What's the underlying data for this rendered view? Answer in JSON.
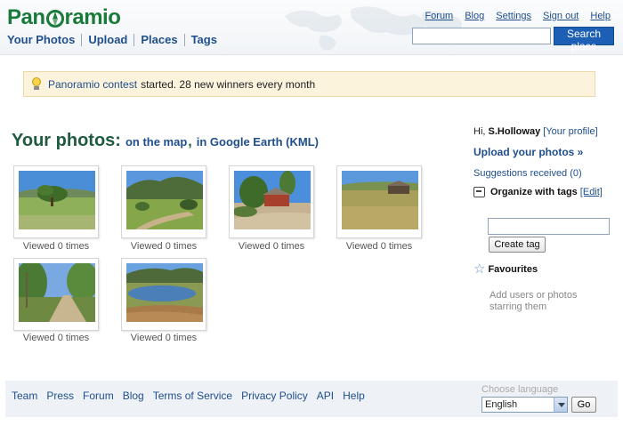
{
  "header": {
    "logo": {
      "before": "Pan",
      "after": "ramio"
    },
    "nav": [
      "Your Photos",
      "Upload",
      "Places",
      "Tags"
    ],
    "top_links": [
      "Forum",
      "Blog",
      "Settings",
      "Sign out",
      "Help"
    ],
    "search": {
      "value": "",
      "button": "Search place"
    }
  },
  "notice": {
    "link": "Panoramio contest",
    "text": "started. 28 new winners every month"
  },
  "title": {
    "main": "Your photos:",
    "map_link": "on the map",
    "comma": ",",
    "earth_link": "in Google Earth (KML)"
  },
  "photos": [
    {
      "caption": "Viewed 0 times"
    },
    {
      "caption": "Viewed 0 times"
    },
    {
      "caption": "Viewed 0 times"
    },
    {
      "caption": "Viewed 0 times"
    },
    {
      "caption": "Viewed 0 times"
    },
    {
      "caption": "Viewed 0 times"
    }
  ],
  "sidebar": {
    "greeting": "Hi,",
    "username": "S.Holloway",
    "profile_link": "[Your profile]",
    "upload_link": "Upload your photos »",
    "suggestions": "Suggestions received (0)",
    "tags_title": "Organize with tags",
    "tags_edit": "[Edit]",
    "tag_input_value": "",
    "create_tag_button": "Create tag",
    "favourites_title": "Favourites",
    "favourites_note": "Add users or photos starring them"
  },
  "footer": {
    "links": [
      "Team",
      "Press",
      "Forum",
      "Blog",
      "Terms of Service",
      "Privacy Policy",
      "API",
      "Help"
    ],
    "language_label": "Choose language",
    "language_value": "English",
    "go_button": "Go"
  },
  "colors": {
    "brand_green": "#1a7a3a",
    "link_blue": "#1f4e8c",
    "search_button": "#1d5fb4",
    "notice_bg": "#fcf3dd"
  }
}
